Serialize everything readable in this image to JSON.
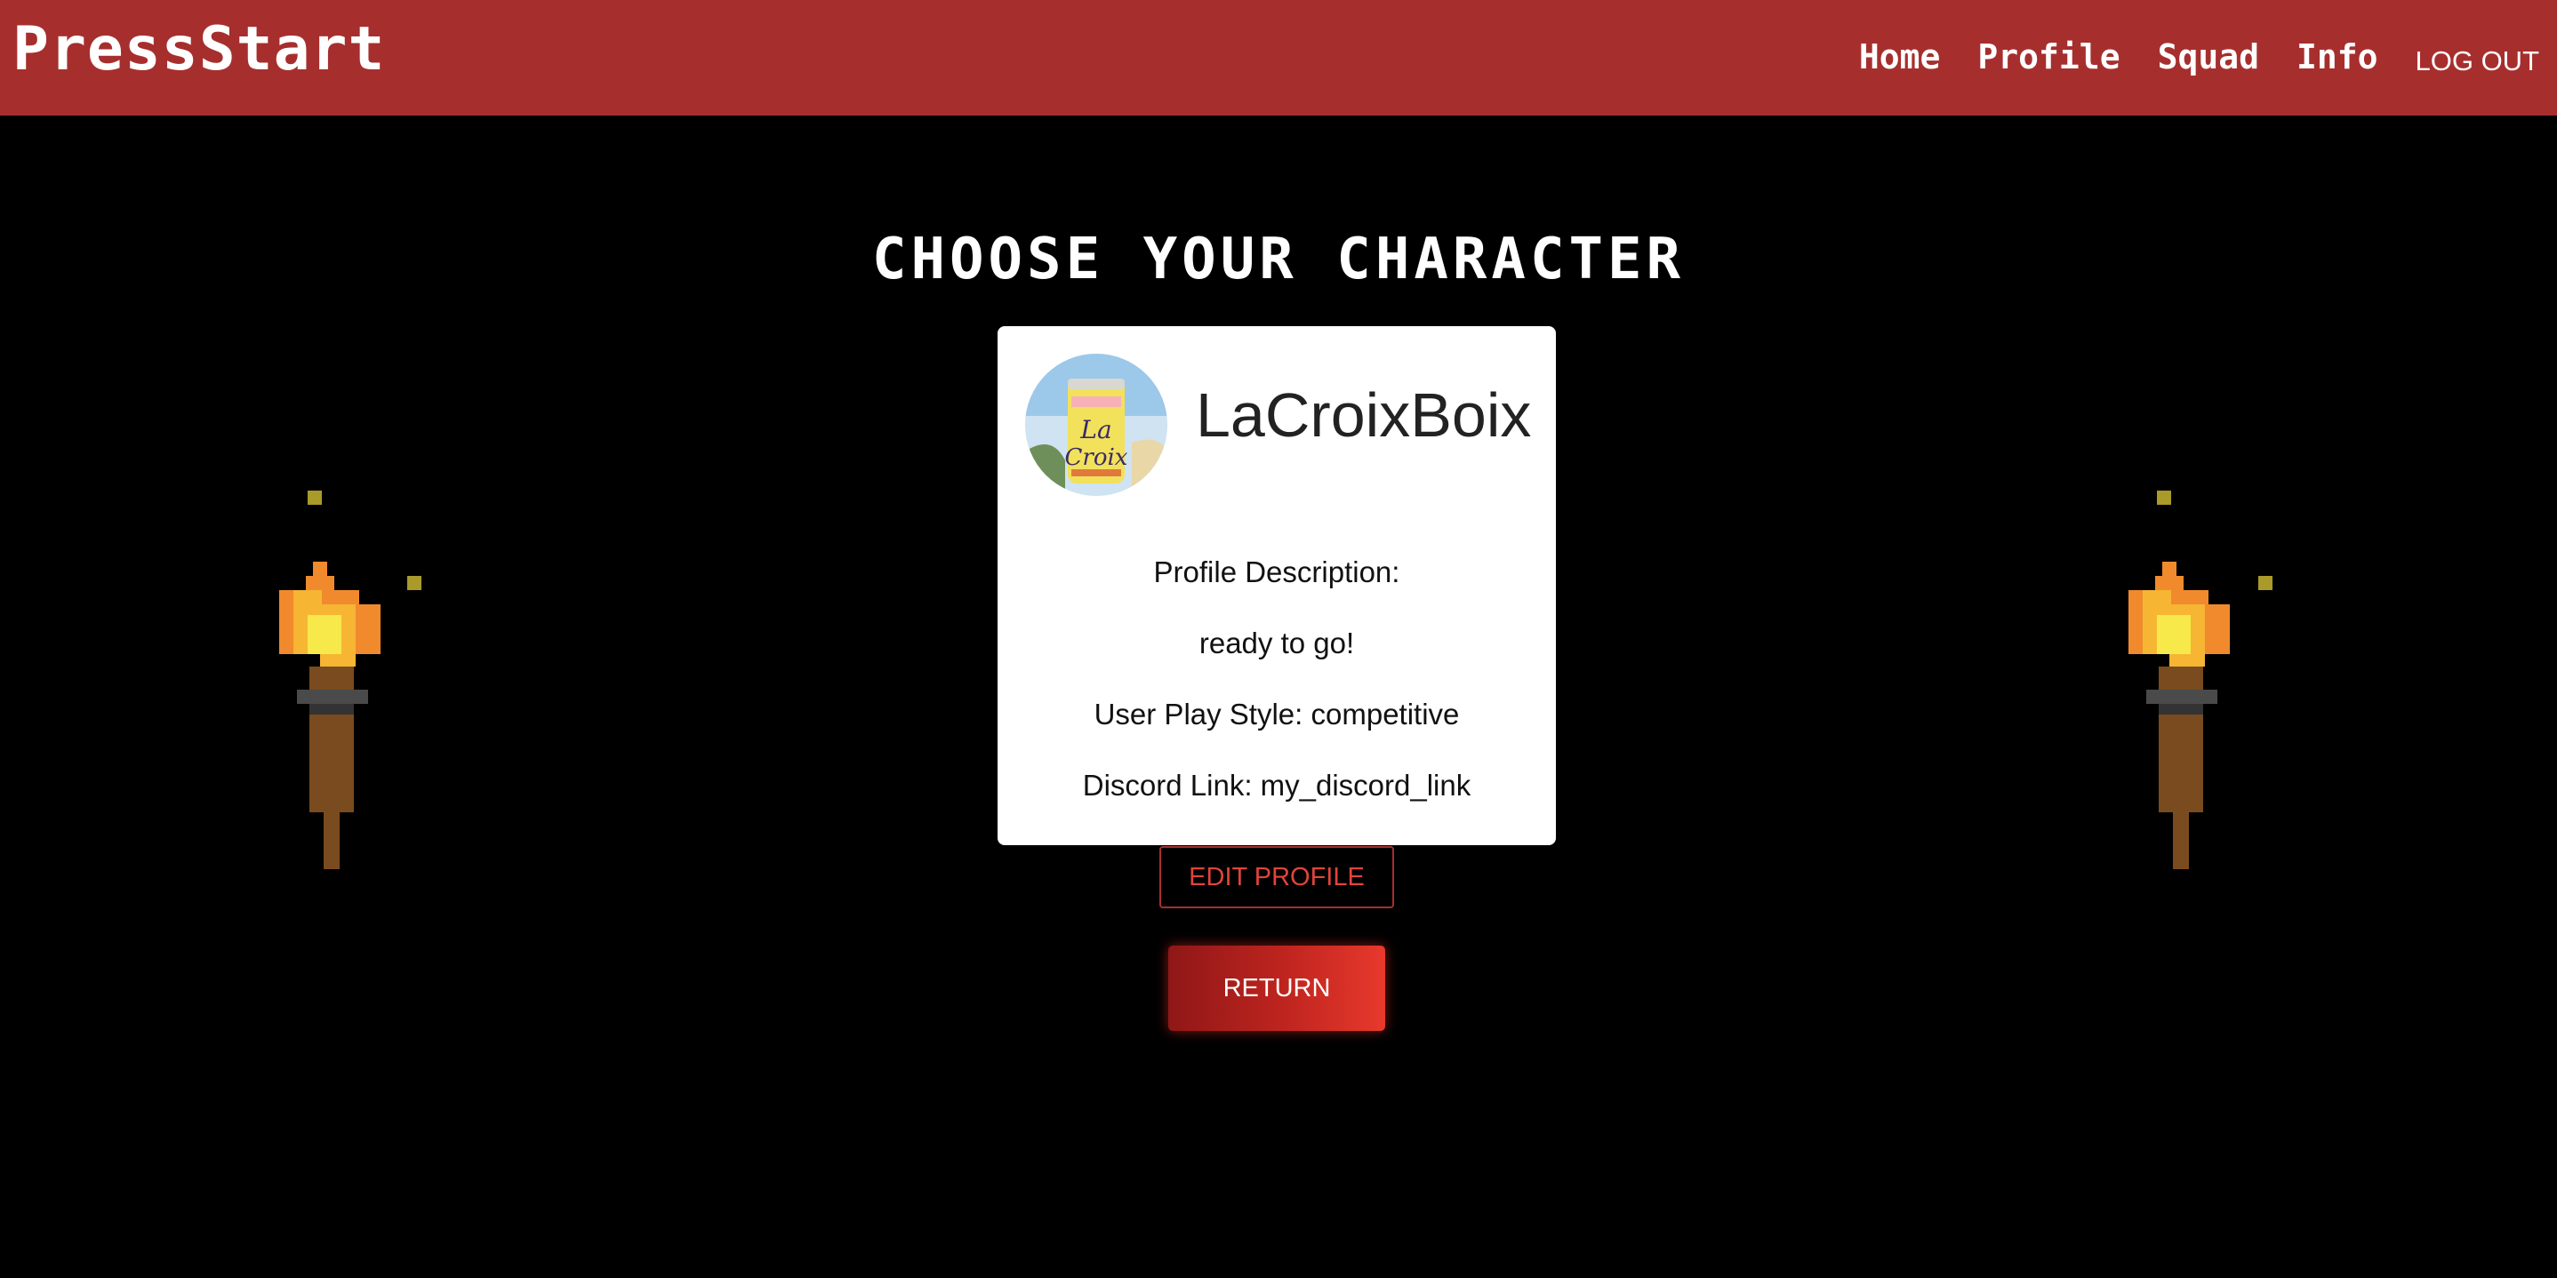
{
  "navbar": {
    "brand": "PressStart",
    "links": [
      {
        "label": "Home"
      },
      {
        "label": "Profile"
      },
      {
        "label": "Squad"
      },
      {
        "label": "Info"
      }
    ],
    "logout_label": "LOG OUT"
  },
  "page": {
    "heading": "CHOOSE YOUR CHARACTER"
  },
  "profile_card": {
    "username": "LaCroixBoix",
    "avatar_icon": "lacroix-can-avatar",
    "description_label": "Profile Description:",
    "description": "ready to go!",
    "play_style": "User Play Style: competitive",
    "discord": "Discord Link: my_discord_link"
  },
  "buttons": {
    "edit_profile": "EDIT PROFILE",
    "return": "RETURN"
  },
  "decorations": {
    "left_torch_icon": "pixel-torch-icon",
    "right_torch_icon": "pixel-torch-icon"
  },
  "colors": {
    "navbar": "#a62f2e",
    "background": "#000000",
    "accent": "#e0443c"
  }
}
